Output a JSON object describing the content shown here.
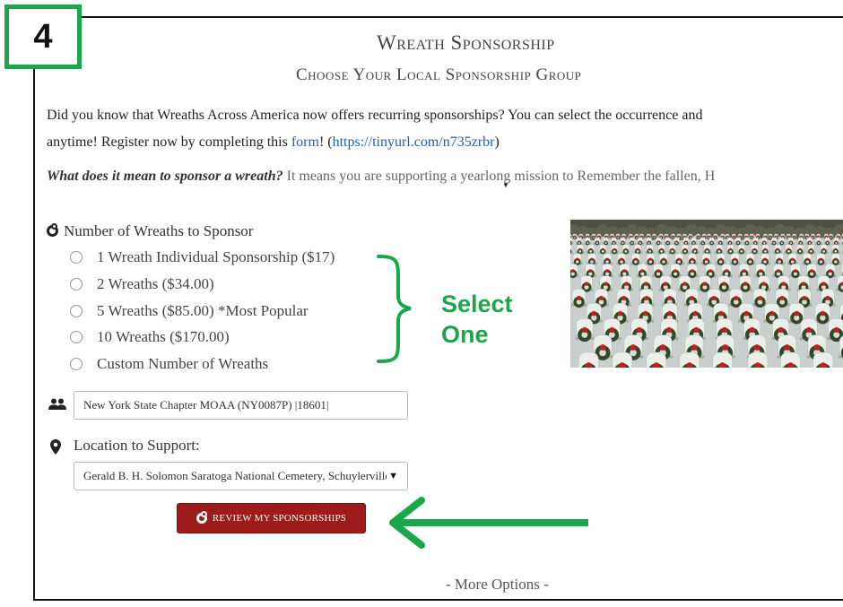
{
  "step_badge": "4",
  "title": "Wreath Sponsorship",
  "subtitle": "Choose Your Local Sponsorship Group",
  "intro": {
    "line1": "Did you know that Wreaths Across America now offers recurring sponsorships? You can select the occurrence and",
    "line2_pre": "anytime! Register now by completing this ",
    "form_link": "form",
    "line2_mid": "! (",
    "url_link": "https://tinyurl.com/n735zrbr",
    "line2_post": ")"
  },
  "mission": {
    "question": "What does it mean to sponsor a wreath?",
    "answer": " It means you are supporting a yearlong mission to Remember the fallen, H"
  },
  "sponsorship": {
    "label": "Number of Wreaths to Sponsor",
    "options": [
      "1 Wreath Individual Sponsorship ($17)",
      "2 Wreaths ($34.00)",
      "5 Wreaths ($85.00) *Most Popular",
      "10 Wreaths ($170.00)",
      "Custom Number of Wreaths"
    ]
  },
  "annotation": {
    "select_line1": "Select",
    "select_line2": "One"
  },
  "group": {
    "value": "New York State Chapter MOAA (NY0087P) |18601|"
  },
  "location": {
    "label": "Location to Support:",
    "selected": "Gerald B. H. Solomon Saratoga National Cemetery, Schuylerville, NY"
  },
  "review_button": "REVIEW MY SPONSORSHIPS",
  "more_options": "- More Options -",
  "colors": {
    "accent_green": "#1aa64a",
    "button_red": "#9e1b1b",
    "link_blue": "#1f5fb8"
  }
}
